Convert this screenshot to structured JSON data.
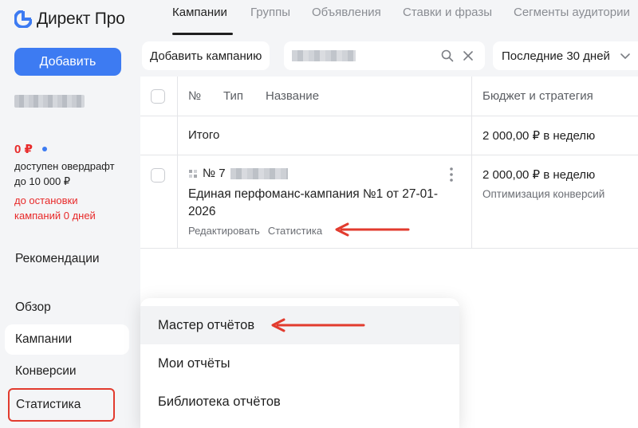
{
  "app": {
    "title": "Директ Про"
  },
  "sidebar": {
    "add_button": "Добавить",
    "balance": "0 ₽",
    "overdraft": "доступен овердрафт до 10 000 ₽",
    "stop_note": "до остановки кампаний 0 дней",
    "items": [
      {
        "label": "Рекомендации"
      },
      {
        "label": "Обзор"
      },
      {
        "label": "Кампании"
      },
      {
        "label": "Конверсии"
      },
      {
        "label": "Статистика"
      }
    ]
  },
  "tabs": [
    {
      "label": "Кампании"
    },
    {
      "label": "Группы"
    },
    {
      "label": "Объявления"
    },
    {
      "label": "Ставки и фразы"
    },
    {
      "label": "Сегменты аудитории"
    }
  ],
  "filters": {
    "add_campaign": "Добавить кампанию",
    "period": "Последние 30 дней"
  },
  "table": {
    "headers": {
      "num": "№",
      "type": "Тип",
      "name": "Название",
      "budget": "Бюджет и стратегия"
    },
    "total": {
      "label": "Итого",
      "budget": "2 000,00 ₽ в неделю"
    },
    "rows": [
      {
        "id_prefix": "№ 7",
        "name": "Единая перфоманс-кампания №1 от 27-01-2026",
        "links": {
          "edit": "Редактировать",
          "stats": "Статистика"
        },
        "budget": "2 000,00 ₽ в неделю",
        "strategy": "Оптимизация конверсий"
      }
    ]
  },
  "dropdown": {
    "items": [
      {
        "label": "Мастер отчётов"
      },
      {
        "label": "Мои отчёты"
      },
      {
        "label": "Библиотека отчётов"
      }
    ]
  },
  "colors": {
    "accent": "#3d7bf2",
    "warning": "#e82a2a",
    "annotation": "#e23b2e"
  }
}
